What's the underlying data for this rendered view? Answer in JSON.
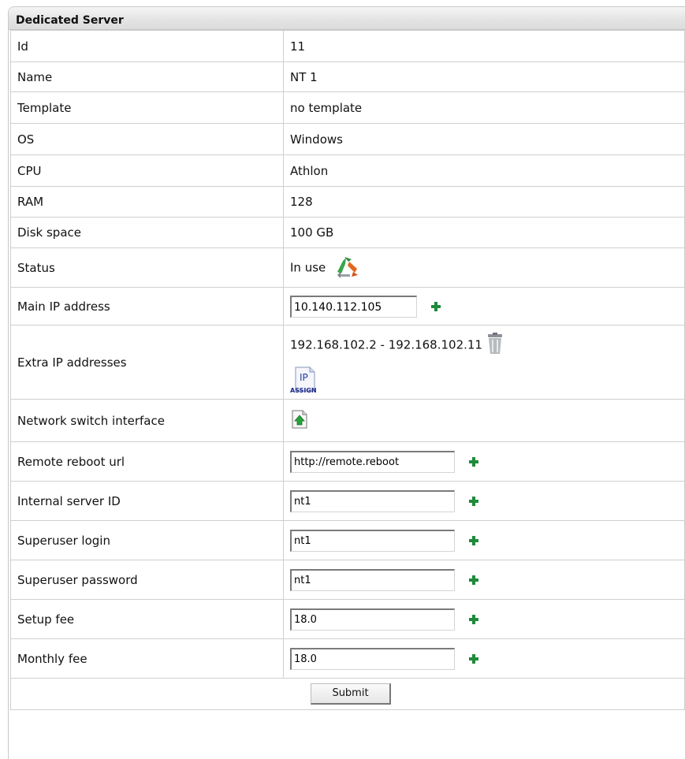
{
  "panel": {
    "title": "Dedicated Server"
  },
  "rows": {
    "id": {
      "label": "Id",
      "value": "11"
    },
    "name": {
      "label": "Name",
      "value": "NT 1"
    },
    "template": {
      "label": "Template",
      "value": "no template"
    },
    "os": {
      "label": "OS",
      "value": "Windows"
    },
    "cpu": {
      "label": "CPU",
      "value": "Athlon"
    },
    "ram": {
      "label": "RAM",
      "value": "128"
    },
    "disk": {
      "label": "Disk space",
      "value": "100 GB"
    },
    "status": {
      "label": "Status",
      "value": "In use",
      "icon": "status-in-use-icon"
    },
    "main_ip": {
      "label": "Main IP address",
      "value": "10.140.112.105",
      "icon": "add-icon"
    },
    "extra_ip": {
      "label": "Extra IP addresses",
      "value": "192.168.102.2 - 192.168.102.11",
      "delete_icon": "trash-icon",
      "assign_icon": "ip-assign-icon",
      "assign_text_top": "IP",
      "assign_text_bottom": "ASSIGN"
    },
    "switch": {
      "label": "Network switch interface",
      "icon": "document-up-arrow-icon"
    },
    "reboot_url": {
      "label": "Remote reboot url",
      "value": "http://remote.reboot"
    },
    "internal_id": {
      "label": "Internal server ID",
      "value": "nt1"
    },
    "su_login": {
      "label": "Superuser login",
      "value": "nt1"
    },
    "su_password": {
      "label": "Superuser password",
      "value": "nt1"
    },
    "setup_fee": {
      "label": "Setup fee",
      "value": "18.0"
    },
    "monthly_fee": {
      "label": "Monthly fee",
      "value": "18.0"
    }
  },
  "submit": {
    "label": "Submit"
  },
  "colors": {
    "plus": "#1f8a3c",
    "border": "#cfcfcf",
    "header_bg": "#e4e4e4"
  }
}
